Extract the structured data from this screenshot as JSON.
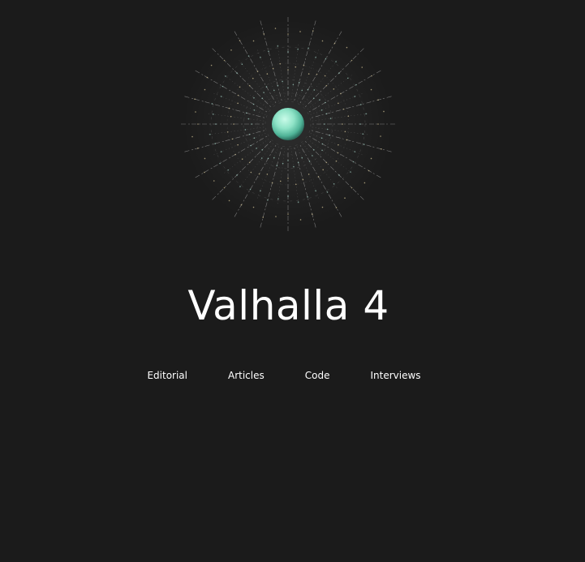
{
  "site": {
    "title": "Valhalla 4"
  },
  "nav": {
    "items": [
      {
        "label": "Editorial"
      },
      {
        "label": "Articles"
      },
      {
        "label": "Code"
      },
      {
        "label": "Interviews"
      }
    ]
  },
  "colors": {
    "background": "#1b1b1b",
    "text": "#ffffff",
    "sphere": "#8ee4c8"
  },
  "icons": {
    "logo": "starburst-sphere-icon"
  }
}
